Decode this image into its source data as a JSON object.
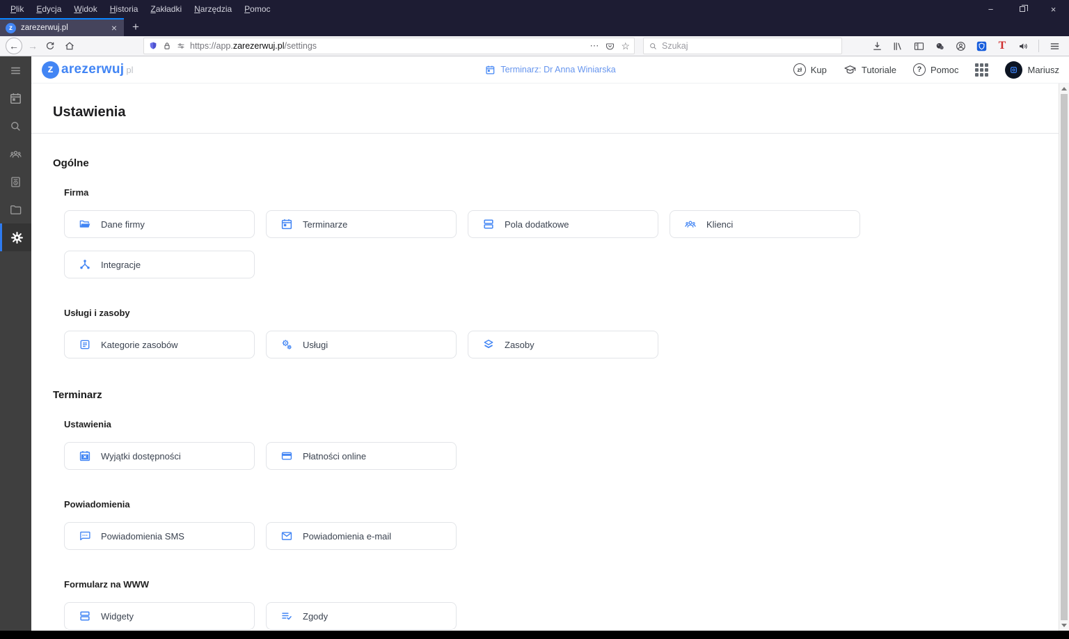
{
  "browser": {
    "menu_items": [
      "Plik",
      "Edycja",
      "Widok",
      "Historia",
      "Zakładki",
      "Narzędzia",
      "Pomoc"
    ],
    "window_controls": {
      "minimize": "−",
      "close": "×"
    },
    "tab": {
      "title": "zarezerwuj.pl",
      "favicon_letter": "z",
      "close_glyph": "×",
      "new_tab_glyph": "+"
    },
    "nav": {
      "back_glyph": "←",
      "forward_glyph": "→"
    },
    "urlbar": {
      "url_prefix": "https://app.",
      "url_domain": "zarezerwuj.pl",
      "url_path": "/settings",
      "more_glyph": "⋯",
      "star_glyph": "☆"
    },
    "search": {
      "placeholder": "Szukaj"
    },
    "toolbar": {
      "t_extension_glyph": "T"
    }
  },
  "app_header": {
    "logo": {
      "circle_letter": "z",
      "brand": "arezerwuj",
      "tld": "pl"
    },
    "schedule_banner": "Terminarz: Dr Anna Winiarska",
    "currency_badge": "zł",
    "buy_label": "Kup",
    "tutorials_label": "Tutoriale",
    "help_badge": "?",
    "help_label": "Pomoc",
    "user_name": "Mariusz"
  },
  "sidebar": {
    "icons": [
      "menu",
      "calendar",
      "search",
      "clients",
      "invoices",
      "files",
      "settings"
    ],
    "active_item": "settings"
  },
  "page": {
    "title": "Ustawienia",
    "sections": [
      {
        "title": "Ogólne",
        "groups": [
          {
            "title": "Firma",
            "cards": [
              {
                "label": "Dane firmy",
                "icon": "folder-open"
              },
              {
                "label": "Terminarze",
                "icon": "calendar"
              },
              {
                "label": "Pola dodatkowe",
                "icon": "rows"
              },
              {
                "label": "Klienci",
                "icon": "clients-group"
              },
              {
                "label": "Integracje",
                "icon": "integration-hub"
              }
            ]
          },
          {
            "title": "Usługi i zasoby",
            "cards": [
              {
                "label": "Kategorie zasobów",
                "icon": "list-document"
              },
              {
                "label": "Usługi",
                "icon": "gears"
              },
              {
                "label": "Zasoby",
                "icon": "layers"
              }
            ]
          }
        ]
      },
      {
        "title": "Terminarz",
        "groups": [
          {
            "title": "Ustawienia",
            "cards": [
              {
                "label": "Wyjątki dostępności",
                "icon": "calendar-busy"
              },
              {
                "label": "Płatności online",
                "icon": "credit-card"
              }
            ]
          },
          {
            "title": "Powiadomienia",
            "cards": [
              {
                "label": "Powiadomienia SMS",
                "icon": "sms-bubble"
              },
              {
                "label": "Powiadomienia e-mail",
                "icon": "envelope"
              }
            ]
          },
          {
            "title": "Formularz na WWW",
            "cards": [
              {
                "label": "Widgety",
                "icon": "rows"
              },
              {
                "label": "Zgody",
                "icon": "list-check"
              }
            ]
          }
        ]
      }
    ]
  },
  "colors": {
    "accent_blue": "#4285f4",
    "titlebar_navy": "#1d1c33",
    "tab_highlight": "#0a84ff",
    "sidebar_gray": "#3f3f3f",
    "sidebar_active_border": "#2e7bf0",
    "link_blue": "#6695ee",
    "bitwarden_blue": "#175ddc",
    "shield_purple": "#5d62e0",
    "t_extension_red": "#cf2e2e"
  }
}
